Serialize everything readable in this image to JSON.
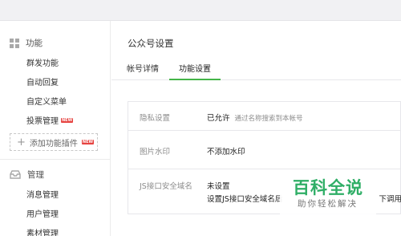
{
  "sidebar": {
    "function_section": {
      "label": "功能",
      "icon": "grid-icon"
    },
    "function_items": [
      {
        "label": "群发功能"
      },
      {
        "label": "自动回复"
      },
      {
        "label": "自定义菜单"
      },
      {
        "label": "投票管理",
        "badge": "NEW"
      }
    ],
    "add_plugin": {
      "label": "添加功能插件",
      "badge": "NEW"
    },
    "manage_section": {
      "label": "管理",
      "icon": "tray-icon"
    },
    "manage_items": [
      {
        "label": "消息管理"
      },
      {
        "label": "用户管理"
      },
      {
        "label": "素材管理"
      }
    ]
  },
  "main": {
    "title": "公众号设置",
    "tabs": [
      {
        "label": "帐号详情",
        "active": false
      },
      {
        "label": "功能设置",
        "active": true
      }
    ],
    "settings": [
      {
        "label": "隐私设置",
        "value": "已允许",
        "hint": "通过名称搜索到本帐号"
      },
      {
        "label": "图片水印",
        "value": "不添加水印"
      },
      {
        "label": "JS接口安全域名",
        "value": "未设置",
        "value_line2": "设置JS接口安全域名后",
        "tail": "下调用"
      }
    ]
  },
  "watermark": {
    "title": "百科全说",
    "subtitle": "助你轻松解决"
  },
  "colors": {
    "accent": "#44b549",
    "badge": "#e64340",
    "watermark": "#2fae66"
  }
}
